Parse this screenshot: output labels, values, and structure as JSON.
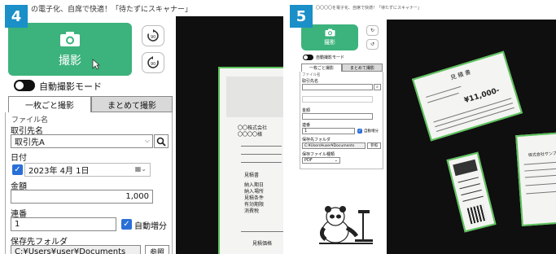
{
  "panels": [
    {
      "badge": "4",
      "title": "の電子化、自席で快適！「待たずにスキャナー」",
      "capture_label": "撮影",
      "auto_mode_label": "自動撮影モード",
      "tabs": [
        "一枚ごと撮影",
        "まとめて撮影"
      ],
      "file_name_section": "ファイル名",
      "client_label": "取引先名",
      "client_value": "取引先A",
      "date_label": "日付",
      "date_value": "2023年  4月  1日",
      "amount_label": "金額",
      "amount_value": "1,000",
      "serial_label": "連番",
      "serial_value": "1",
      "auto_increment_label": "自動増分",
      "save_folder_label": "保存先フォルダ",
      "save_folder_value": "C:¥Users¥user¥Documents",
      "browse_label": "参照",
      "preview_lines": [
        "〇〇株式会社",
        "〇〇〇〇様",
        "見積書",
        "納入期日",
        "納入場所",
        "見積条件",
        "有効期限",
        "消費税",
        "見積価格"
      ]
    },
    {
      "badge": "5",
      "title": "〇〇〇〇を電子化、自席で快適！「待たずにスキャナー」",
      "capture_label": "撮影",
      "auto_mode_label": "自動撮影モード",
      "tabs": [
        "一枚ごと撮影",
        "まとめて撮影"
      ],
      "file_name_section": "ファイル名",
      "client_label": "取引先名",
      "amount_label": "金額",
      "serial_label": "連番",
      "serial_value": "1",
      "auto_increment_label": "自動増分",
      "save_folder_label": "保存先フォルダ",
      "save_folder_value": "C:¥Users¥user¥Documents",
      "browse_label": "参照",
      "file_type_label": "保存ファイル種類",
      "file_type_value": "PDF",
      "invoice_title": "見 積 書",
      "invoice_amount": "¥11,000-",
      "receipt_title": "株式会社サンプル"
    }
  ],
  "colors": {
    "accent_green": "#3cb37c",
    "badge_blue": "#1a8fc8",
    "frame_green": "#5cc35c",
    "check_blue": "#2a6fd6"
  },
  "icons": [
    "camera-icon",
    "rotate-right-icon",
    "rotate-left-icon",
    "search-icon",
    "calendar-icon",
    "chevron-down-icon",
    "checkmark-icon",
    "cursor-icon",
    "panda-illustration"
  ]
}
